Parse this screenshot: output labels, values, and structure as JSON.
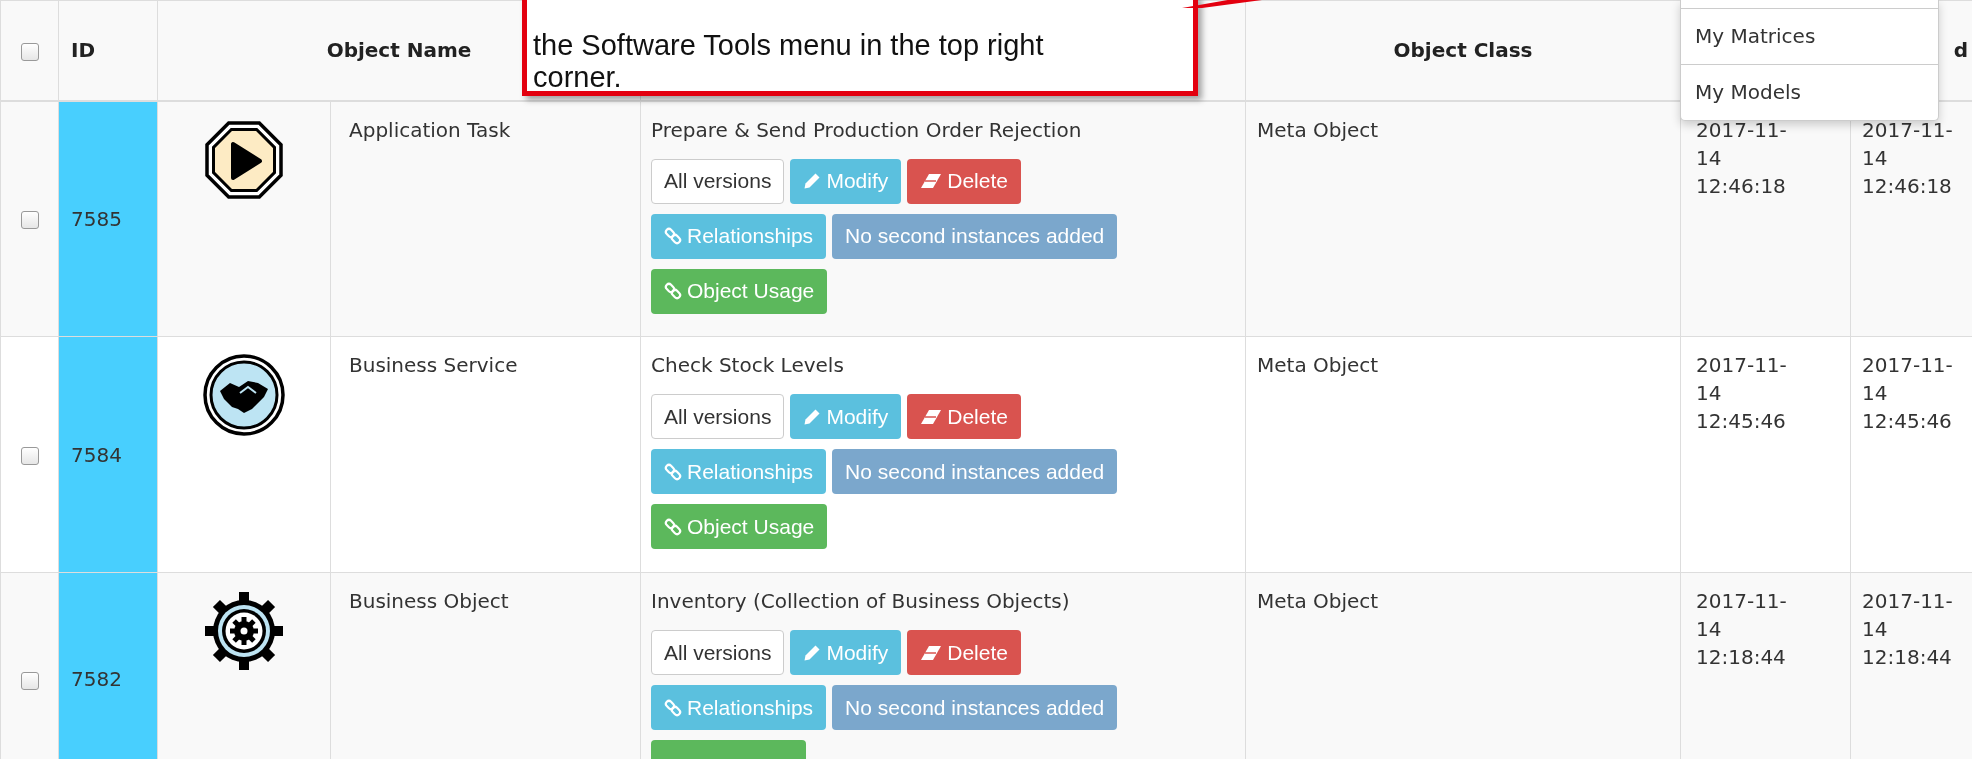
{
  "header": {
    "select_all_checked": false,
    "id": "ID",
    "object_name": "Object Name",
    "object_class": "Object Class",
    "column_8": "d"
  },
  "rows": [
    {
      "checked": false,
      "id": "7585",
      "kind": "play",
      "name": "Application Task",
      "description": "Prepare & Send Production Order Rejection",
      "class": "Meta Object",
      "column_7": "2017-11-14 12:46:18",
      "column_8": "2017-11-14 12:46:18",
      "buttons": [
        {
          "kind": "versions",
          "label": "All versions"
        },
        {
          "kind": "modify",
          "label": "Modify"
        },
        {
          "kind": "delete",
          "label": "Delete"
        },
        {
          "kind": "relationships",
          "label": "Relationships"
        },
        {
          "kind": "info",
          "label": "No second instances added"
        },
        {
          "kind": "usage",
          "label": "Object Usage"
        }
      ]
    },
    {
      "checked": false,
      "id": "7584",
      "kind": "handshake",
      "name": "Business Service",
      "description": "Check Stock Levels",
      "class": "Meta Object",
      "column_7": "2017-11-14 12:45:46",
      "column_8": "2017-11-14 12:45:46",
      "buttons": [
        {
          "kind": "versions",
          "label": "All versions"
        },
        {
          "kind": "modify",
          "label": "Modify"
        },
        {
          "kind": "delete",
          "label": "Delete"
        },
        {
          "kind": "relationships",
          "label": "Relationships"
        },
        {
          "kind": "info",
          "label": "No second instances added"
        },
        {
          "kind": "usage",
          "label": "Object Usage"
        }
      ]
    },
    {
      "checked": false,
      "id": "7582",
      "kind": "gear",
      "name": "Business Object",
      "description": "Inventory (Collection of Business Objects)",
      "class": "Meta Object",
      "column_7": "2017-11-14 12:18:44",
      "column_8": "2017-11-14 12:18:44",
      "buttons": [
        {
          "kind": "versions",
          "label": "All versions"
        },
        {
          "kind": "modify",
          "label": "Modify"
        },
        {
          "kind": "delete",
          "label": "Delete"
        },
        {
          "kind": "relationships",
          "label": "Relationships"
        },
        {
          "kind": "info",
          "label": "No second instances added"
        },
        {
          "kind": "usage"
        }
      ]
    }
  ],
  "callout": {
    "text": "the Software Tools menu in the top right corner."
  },
  "dropdown": {
    "items": [
      {
        "label": "My Matrices"
      },
      {
        "label": "My Models"
      }
    ]
  }
}
